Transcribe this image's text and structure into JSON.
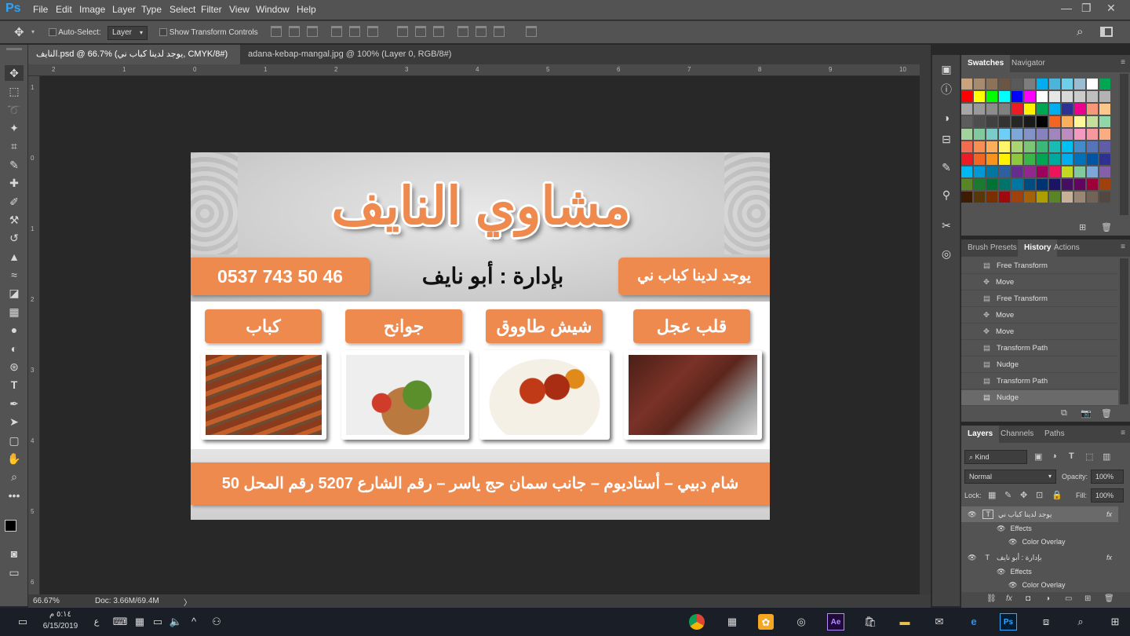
{
  "app": {
    "logo": "Ps",
    "menu": [
      "File",
      "Edit",
      "Image",
      "Layer",
      "Type",
      "Select",
      "Filter",
      "View",
      "Window",
      "Help"
    ]
  },
  "options": {
    "auto_select": "Auto-Select:",
    "auto_select_value": "Layer",
    "show_transform": "Show Transform Controls"
  },
  "tabs": [
    {
      "label": "النايف.psd @ 66.7% (يوجد لدينا كباب ني, CMYK/8#) *"
    },
    {
      "label": "adana-kebap-mangal.jpg @ 100% (Layer 0, RGB/8#) *"
    }
  ],
  "ruler": {
    "top": [
      "2",
      "1",
      "0",
      "1",
      "2",
      "3",
      "4",
      "5",
      "6",
      "7",
      "8",
      "9",
      "10"
    ],
    "left": [
      "1",
      "0",
      "1",
      "2",
      "3",
      "4",
      "5",
      "6"
    ]
  },
  "document": {
    "title": "مشاوي النايف",
    "phone": "0537 743 50 46",
    "manager": "بإدارة : أبو نايف",
    "kebab_note": "يوجد لدينا كباب ني",
    "menu_labels": [
      "كباب",
      "جوانح",
      "شيش طاووق",
      "قلب عجل"
    ],
    "address": "شام دبيي – أستاديوم – جانب سمان حج ياسر – رقم الشارع 5207 رقم المحل 50"
  },
  "status": {
    "zoom": "66.67%",
    "doc": "Doc: 3.66M/69.4M"
  },
  "panels": {
    "swatches_tabs": [
      "Swatches",
      "Navigator"
    ],
    "swatch_colors": [
      [
        "#c8a37c",
        "#a78b6e",
        "#8b7259",
        "#6b5646",
        "#5a5a5a",
        "#7d7d7d",
        "#00aeef",
        "#4bb4d8",
        "#6dd0e8",
        "#9cbcd1",
        "#ffffff",
        "#00a651"
      ],
      [
        "#ff0000",
        "#ffff00",
        "#00ff00",
        "#00ffff",
        "#0000ff",
        "#ff00ff",
        "#ffffff",
        "#e6e6e6",
        "#d9d9d9",
        "#cccccc",
        "#bfbfbf",
        "#b3b3b3"
      ],
      [
        "#a6a6a6",
        "#999999",
        "#8c8c8c",
        "#808080",
        "#ed1c24",
        "#fff200",
        "#00a651",
        "#00aeef",
        "#2e3192",
        "#ec008c",
        "#f7977a",
        "#fdc68a"
      ],
      [
        "#5d5d5d",
        "#4d4d4d",
        "#404040",
        "#333333",
        "#262626",
        "#1a1a1a",
        "#000000",
        "#f26522",
        "#fbaf5d",
        "#fff799",
        "#c4df9b",
        "#8fd7a9"
      ],
      [
        "#a3d39c",
        "#82ca9d",
        "#7accc8",
        "#6dcff6",
        "#7da7d9",
        "#8393ca",
        "#8781bd",
        "#a186be",
        "#bd8cbf",
        "#f49ac1",
        "#f6989d",
        "#f9ad81"
      ],
      [
        "#f26c4f",
        "#f68e56",
        "#fbaf5d",
        "#fff568",
        "#acd373",
        "#7cc576",
        "#3bb878",
        "#1abbb4",
        "#00bff3",
        "#438ccb",
        "#5574b9",
        "#605ca8"
      ],
      [
        "#ed1c24",
        "#f26522",
        "#f7941d",
        "#fff200",
        "#8dc73f",
        "#39b54a",
        "#00a651",
        "#00a99d",
        "#00aeef",
        "#0072bc",
        "#0054a6",
        "#2e3192"
      ],
      [
        "#00b8f1",
        "#0099d6",
        "#0076a3",
        "#2e5f9e",
        "#662d91",
        "#92278f",
        "#9e005d",
        "#ed145b",
        "#c4d71f",
        "#82ca9c",
        "#7ba7d9",
        "#8560a8"
      ],
      [
        "#598527",
        "#1a7b30",
        "#007236",
        "#00746b",
        "#0076a3",
        "#004b80",
        "#003471",
        "#1b1464",
        "#440e62",
        "#630460",
        "#9e0039",
        "#a0410d"
      ],
      [
        "#3e1a00",
        "#58370b",
        "#7b2e00",
        "#9e0b0f",
        "#a0410d",
        "#a36209",
        "#aba000",
        "#598527",
        "#c7b299",
        "#998675",
        "#736357",
        "#534741"
      ]
    ],
    "panel2_tabs": [
      "Brush Presets",
      "History",
      "Actions"
    ],
    "history": [
      "Free Transform",
      "Move",
      "Free Transform",
      "Move",
      "Move",
      "Transform Path",
      "Nudge",
      "Transform Path",
      "Nudge"
    ],
    "layers_tabs": [
      "Layers",
      "Channels",
      "Paths"
    ],
    "kind": "Kind",
    "blend_mode": "Normal",
    "opacity_label": "Opacity:",
    "opacity": "100%",
    "lock_label": "Lock:",
    "fill_label": "Fill:",
    "fill": "100%",
    "layers": [
      {
        "name": "يوجد لدينا كباب ني",
        "effects": "Effects",
        "effect": "Color Overlay"
      },
      {
        "name": "بإدارة : أبو نايف",
        "effects": "Effects",
        "effect": "Color Overlay"
      }
    ]
  },
  "taskbar": {
    "time": "٥:١٤ م",
    "date": "6/15/2019",
    "lang": "ع"
  }
}
